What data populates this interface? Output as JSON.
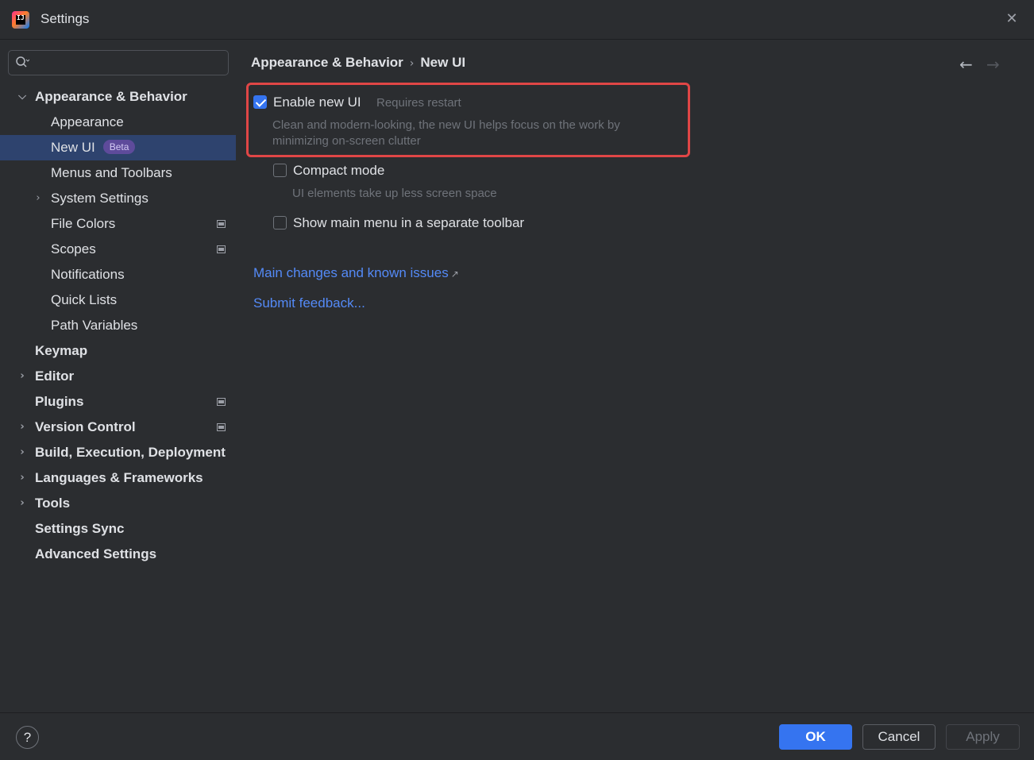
{
  "window": {
    "title": "Settings",
    "close_glyph": "✕"
  },
  "sidebar": {
    "search": {
      "value": "",
      "placeholder": ""
    },
    "items": [
      {
        "label": "Appearance & Behavior",
        "chevron": "⌄",
        "bold": true
      },
      {
        "label": "Appearance"
      },
      {
        "label": "New UI",
        "badge": "Beta",
        "selected": true
      },
      {
        "label": "Menus and Toolbars"
      },
      {
        "label": "System Settings",
        "chevron": "›"
      },
      {
        "label": "File Colors",
        "project_icon": true
      },
      {
        "label": "Scopes",
        "project_icon": true
      },
      {
        "label": "Notifications"
      },
      {
        "label": "Quick Lists"
      },
      {
        "label": "Path Variables"
      },
      {
        "label": "Keymap",
        "bold": true
      },
      {
        "label": "Editor",
        "chevron": "›",
        "bold": true
      },
      {
        "label": "Plugins",
        "bold": true,
        "project_icon": true
      },
      {
        "label": "Version Control",
        "chevron": "›",
        "bold": true,
        "project_icon": true
      },
      {
        "label": "Build, Execution, Deployment",
        "chevron": "›",
        "bold": true
      },
      {
        "label": "Languages & Frameworks",
        "chevron": "›",
        "bold": true
      },
      {
        "label": "Tools",
        "chevron": "›",
        "bold": true
      },
      {
        "label": "Settings Sync",
        "bold": true
      },
      {
        "label": "Advanced Settings",
        "bold": true
      }
    ]
  },
  "main": {
    "breadcrumb": {
      "parent": "Appearance & Behavior",
      "separator": "›",
      "current": "New UI"
    },
    "nav": {
      "back": "←",
      "forward": "→"
    },
    "options": {
      "enable_new_ui": {
        "label": "Enable new UI",
        "hint": "Requires restart",
        "checked": true,
        "description_line1": "Clean and modern-looking, the new UI helps focus on the work by",
        "description_line2": "minimizing on-screen clutter"
      },
      "compact_mode": {
        "label": "Compact mode",
        "checked": false,
        "description": "UI elements take up less screen space"
      },
      "main_menu_toolbar": {
        "label": "Show main menu in a separate toolbar",
        "checked": false
      }
    },
    "links": {
      "main_changes": "Main changes and known issues",
      "main_changes_arrow": "↗",
      "submit_feedback": "Submit feedback..."
    }
  },
  "footer": {
    "help": "?",
    "ok": "OK",
    "cancel": "Cancel",
    "apply": "Apply"
  },
  "colors": {
    "accent": "#3574f0",
    "link": "#548af7",
    "highlight_border": "#e04646",
    "selection": "#2e436e"
  }
}
